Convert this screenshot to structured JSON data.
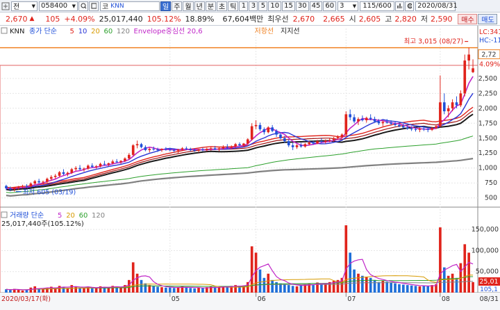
{
  "toolbar": {
    "code_value": "058400",
    "dropdown_prefix": "전",
    "stock_prefix": "코",
    "stock_name": "KNN",
    "periods": [
      "일",
      "주",
      "월",
      "년",
      "분",
      "초",
      "틱"
    ],
    "intervals": [
      "1",
      "3",
      "5",
      "10",
      "15",
      "30",
      "45",
      "60"
    ],
    "interval_value": "3",
    "count": "115/600",
    "date": "2020/08/31"
  },
  "quote": {
    "price": "2,670",
    "change": "105",
    "change_pct": "+4.09%",
    "volume": "25,017,440",
    "vol_ratio": "105.12%",
    "turnover": "18.89%",
    "amount": "67,604백만",
    "priority_label": "최우선",
    "ask": "2,670",
    "bid": "2,665",
    "open_label": "시",
    "open": "2,605",
    "high_label": "고",
    "high": "2,820",
    "low_label": "저",
    "low": "2,590",
    "buy_label": "매수",
    "sell_label": "매도"
  },
  "colors": {
    "up": "#e0231b",
    "down": "#1f4fd8",
    "ma5": "#e0231b",
    "ma10": "#2a36d6",
    "ma20": "#d79a00",
    "ma60": "#2ca02c",
    "ma120": "#808080",
    "env": "#c026c8",
    "resist": "#f08020"
  },
  "legend": {
    "name": "KNN",
    "items": [
      {
        "text": "종가 단순",
        "color": "#1f4fd8"
      },
      {
        "text": "5",
        "color": "#e0231b"
      },
      {
        "text": "10",
        "color": "#2a36d6"
      },
      {
        "text": "20",
        "color": "#d79a00"
      },
      {
        "text": "60",
        "color": "#2ca02c"
      },
      {
        "text": "120",
        "color": "#808080"
      },
      {
        "text": "Envelope중심선 20,6",
        "color": "#c026c8"
      },
      {
        "text": "저항선",
        "color": "#f08020"
      },
      {
        "text": "지지선",
        "color": "#222222"
      }
    ],
    "vol_items": [
      {
        "text": "거래량 단순",
        "color": "#1f4fd8"
      },
      {
        "text": "5",
        "color": "#c026c8"
      },
      {
        "text": "20",
        "color": "#d79a00"
      },
      {
        "text": "60",
        "color": "#2ca02c"
      },
      {
        "text": "120",
        "color": "#808080"
      }
    ],
    "vol_current": "25,017,440주(105.12%)"
  },
  "annotations": {
    "high": "최고 3,015 (08/27)",
    "low": "최저 605 (03/19)",
    "lc": "LC:341",
    "hc": "HC:-11",
    "price_tag": "2,72",
    "pct_tag": "4.09%",
    "vol_tag": "25,01",
    "vol_tag2": "105,1"
  },
  "chart_data": {
    "type": "candlestick",
    "x_start": "2020/03/17",
    "x_start_label": "2020/03/17(화)",
    "month_ticks": [
      {
        "label": "05",
        "index": 40
      },
      {
        "label": "06",
        "index": 61
      },
      {
        "label": "07",
        "index": 83
      },
      {
        "label": "08",
        "index": 106
      }
    ],
    "x_end_label": "08/31",
    "y_ticks": [
      "2,500",
      "2,250",
      "2,000",
      "1,750",
      "1,500",
      "1,250",
      "1,000",
      "750",
      "500"
    ],
    "y_range": [
      380,
      3150
    ],
    "vol_ticks": [
      "150,000",
      "100,000",
      "50,000"
    ],
    "vol_range": [
      0,
      180000
    ],
    "resistance": 3015,
    "support": 2720,
    "ohlc": [
      [
        700,
        720,
        630,
        660
      ],
      [
        660,
        690,
        610,
        640
      ],
      [
        645,
        680,
        605,
        670
      ],
      [
        670,
        700,
        640,
        690
      ],
      [
        690,
        720,
        660,
        700
      ],
      [
        700,
        730,
        670,
        690
      ],
      [
        690,
        760,
        680,
        740
      ],
      [
        740,
        800,
        720,
        780
      ],
      [
        780,
        820,
        740,
        760
      ],
      [
        760,
        790,
        720,
        770
      ],
      [
        770,
        840,
        750,
        820
      ],
      [
        820,
        880,
        790,
        850
      ],
      [
        850,
        900,
        820,
        870
      ],
      [
        870,
        950,
        850,
        930
      ],
      [
        930,
        980,
        880,
        900
      ],
      [
        900,
        940,
        860,
        920
      ],
      [
        920,
        1000,
        900,
        980
      ],
      [
        980,
        1030,
        950,
        1000
      ],
      [
        1000,
        1050,
        960,
        980
      ],
      [
        980,
        1010,
        940,
        990
      ],
      [
        990,
        1060,
        970,
        1040
      ],
      [
        1040,
        1080,
        1000,
        1020
      ],
      [
        1020,
        1050,
        990,
        1030
      ],
      [
        1030,
        1090,
        1010,
        1070
      ],
      [
        1070,
        1120,
        1040,
        1060
      ],
      [
        1060,
        1090,
        1030,
        1080
      ],
      [
        1080,
        1140,
        1060,
        1110
      ],
      [
        1110,
        1150,
        1080,
        1100
      ],
      [
        1100,
        1130,
        1070,
        1120
      ],
      [
        1120,
        1180,
        1100,
        1160
      ],
      [
        1160,
        1250,
        1140,
        1220
      ],
      [
        1220,
        1400,
        1200,
        1380
      ],
      [
        1380,
        1460,
        1330,
        1400
      ],
      [
        1400,
        1420,
        1330,
        1350
      ],
      [
        1350,
        1380,
        1280,
        1300
      ],
      [
        1300,
        1340,
        1260,
        1320
      ],
      [
        1320,
        1360,
        1290,
        1310
      ],
      [
        1310,
        1340,
        1270,
        1300
      ],
      [
        1300,
        1330,
        1270,
        1320
      ],
      [
        1320,
        1350,
        1290,
        1310
      ],
      [
        1310,
        1340,
        1280,
        1300
      ],
      [
        1300,
        1330,
        1260,
        1290
      ],
      [
        1290,
        1320,
        1250,
        1310
      ],
      [
        1310,
        1350,
        1290,
        1330
      ],
      [
        1330,
        1360,
        1300,
        1320
      ],
      [
        1320,
        1340,
        1280,
        1300
      ],
      [
        1300,
        1330,
        1270,
        1290
      ],
      [
        1290,
        1320,
        1260,
        1310
      ],
      [
        1310,
        1340,
        1280,
        1300
      ],
      [
        1300,
        1340,
        1280,
        1320
      ],
      [
        1320,
        1360,
        1290,
        1330
      ],
      [
        1330,
        1370,
        1300,
        1310
      ],
      [
        1310,
        1350,
        1280,
        1330
      ],
      [
        1330,
        1380,
        1310,
        1350
      ],
      [
        1350,
        1400,
        1320,
        1340
      ],
      [
        1340,
        1380,
        1310,
        1360
      ],
      [
        1360,
        1420,
        1340,
        1400
      ],
      [
        1400,
        1430,
        1360,
        1380
      ],
      [
        1380,
        1420,
        1350,
        1410
      ],
      [
        1410,
        1500,
        1390,
        1480
      ],
      [
        1480,
        1750,
        1460,
        1700
      ],
      [
        1700,
        1800,
        1650,
        1720
      ],
      [
        1720,
        1760,
        1620,
        1650
      ],
      [
        1650,
        1680,
        1560,
        1600
      ],
      [
        1600,
        1700,
        1580,
        1680
      ],
      [
        1680,
        1720,
        1600,
        1620
      ],
      [
        1620,
        1650,
        1520,
        1560
      ],
      [
        1560,
        1600,
        1480,
        1500
      ],
      [
        1500,
        1540,
        1420,
        1450
      ],
      [
        1450,
        1480,
        1350,
        1380
      ],
      [
        1380,
        1420,
        1300,
        1350
      ],
      [
        1350,
        1400,
        1320,
        1380
      ],
      [
        1380,
        1420,
        1340,
        1360
      ],
      [
        1360,
        1420,
        1340,
        1400
      ],
      [
        1400,
        1450,
        1380,
        1430
      ],
      [
        1430,
        1460,
        1390,
        1410
      ],
      [
        1410,
        1470,
        1400,
        1450
      ],
      [
        1450,
        1500,
        1420,
        1440
      ],
      [
        1440,
        1480,
        1410,
        1460
      ],
      [
        1460,
        1500,
        1430,
        1470
      ],
      [
        1470,
        1520,
        1440,
        1500
      ],
      [
        1500,
        1550,
        1470,
        1520
      ],
      [
        1520,
        1580,
        1490,
        1560
      ],
      [
        1560,
        1950,
        1540,
        1900
      ],
      [
        1900,
        1980,
        1800,
        1850
      ],
      [
        1850,
        1900,
        1750,
        1780
      ],
      [
        1780,
        1850,
        1720,
        1820
      ],
      [
        1820,
        1880,
        1780,
        1800
      ],
      [
        1800,
        1860,
        1760,
        1840
      ],
      [
        1840,
        1900,
        1800,
        1820
      ],
      [
        1820,
        1860,
        1760,
        1780
      ],
      [
        1780,
        1820,
        1720,
        1750
      ],
      [
        1750,
        1800,
        1700,
        1770
      ],
      [
        1770,
        1820,
        1740,
        1760
      ],
      [
        1760,
        1800,
        1720,
        1740
      ],
      [
        1740,
        1780,
        1700,
        1720
      ],
      [
        1720,
        1760,
        1680,
        1700
      ],
      [
        1700,
        1740,
        1660,
        1680
      ],
      [
        1680,
        1720,
        1640,
        1660
      ],
      [
        1660,
        1700,
        1620,
        1650
      ],
      [
        1650,
        1690,
        1610,
        1640
      ],
      [
        1640,
        1680,
        1600,
        1660
      ],
      [
        1660,
        1700,
        1620,
        1650
      ],
      [
        1650,
        1680,
        1600,
        1640
      ],
      [
        1640,
        1690,
        1620,
        1670
      ],
      [
        1670,
        1720,
        1650,
        1700
      ],
      [
        1700,
        2550,
        1680,
        2100
      ],
      [
        2100,
        2250,
        1900,
        1950
      ],
      [
        1950,
        2050,
        1850,
        2000
      ],
      [
        2000,
        2150,
        1950,
        2100
      ],
      [
        2100,
        2200,
        2000,
        2050
      ],
      [
        2050,
        2300,
        2020,
        2250
      ],
      [
        2250,
        2900,
        2200,
        2800
      ],
      [
        2800,
        3015,
        2650,
        2900
      ],
      [
        2605,
        2820,
        2590,
        2670
      ]
    ],
    "volume": [
      8000,
      6000,
      9000,
      7000,
      5000,
      6000,
      12000,
      15000,
      10000,
      8000,
      11000,
      14000,
      12000,
      16000,
      13000,
      10000,
      18000,
      15000,
      12000,
      10000,
      14000,
      12000,
      11000,
      15000,
      13000,
      12000,
      16000,
      14000,
      12000,
      18000,
      30000,
      72000,
      45000,
      30000,
      22000,
      18000,
      15000,
      14000,
      13000,
      12000,
      12000,
      11000,
      13000,
      15000,
      12000,
      11000,
      10000,
      12000,
      11000,
      13000,
      14000,
      12000,
      13000,
      15000,
      14000,
      16000,
      18000,
      15000,
      17000,
      25000,
      110000,
      95000,
      55000,
      35000,
      45000,
      30000,
      25000,
      22000,
      20000,
      18000,
      16000,
      15000,
      18000,
      20000,
      22000,
      18000,
      24000,
      20000,
      22000,
      25000,
      28000,
      30000,
      35000,
      160000,
      95000,
      55000,
      45000,
      40000,
      38000,
      35000,
      30000,
      25000,
      28000,
      26000,
      24000,
      22000,
      20000,
      19000,
      18000,
      17000,
      16000,
      15000,
      16000,
      15000,
      18000,
      20000,
      155000,
      60000,
      40000,
      45000,
      35000,
      70000,
      115000,
      95000,
      25000
    ]
  }
}
